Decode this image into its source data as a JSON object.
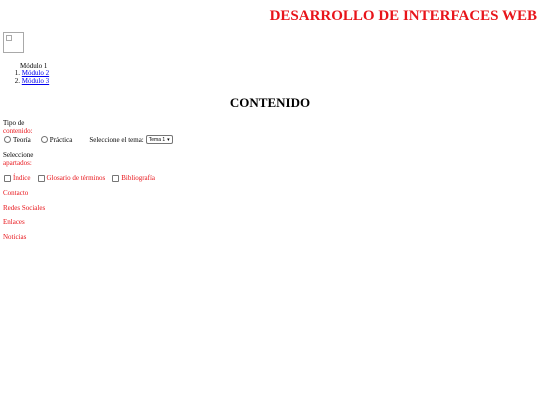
{
  "header": {
    "title": "DESARROLLO DE INTERFACES WEB"
  },
  "nav": {
    "plain_item": "Módulo 1",
    "items": [
      {
        "num": "1.",
        "label": "Módulo 2"
      },
      {
        "num": "2.",
        "label": "Módulo 3"
      }
    ]
  },
  "main": {
    "heading": "CONTENIDO",
    "tipo": {
      "label_line1": "Tipo de",
      "label_line2": "contenido:",
      "options": [
        "Teoría",
        "Práctica"
      ]
    },
    "tema": {
      "label": "Seleccione el tema:",
      "selected": "Tema 1"
    },
    "apartados": {
      "label_line1": "Seleccione",
      "label_line2": "apartados:",
      "options": [
        "Índice",
        "Glosario de términos",
        "Bibliografía"
      ]
    }
  },
  "footer": {
    "links": [
      "Contacto",
      "Redes Sociales",
      "Enlaces",
      "Noticias"
    ]
  },
  "colors": {
    "accent": "#e8141a",
    "link": "#0000ee"
  }
}
